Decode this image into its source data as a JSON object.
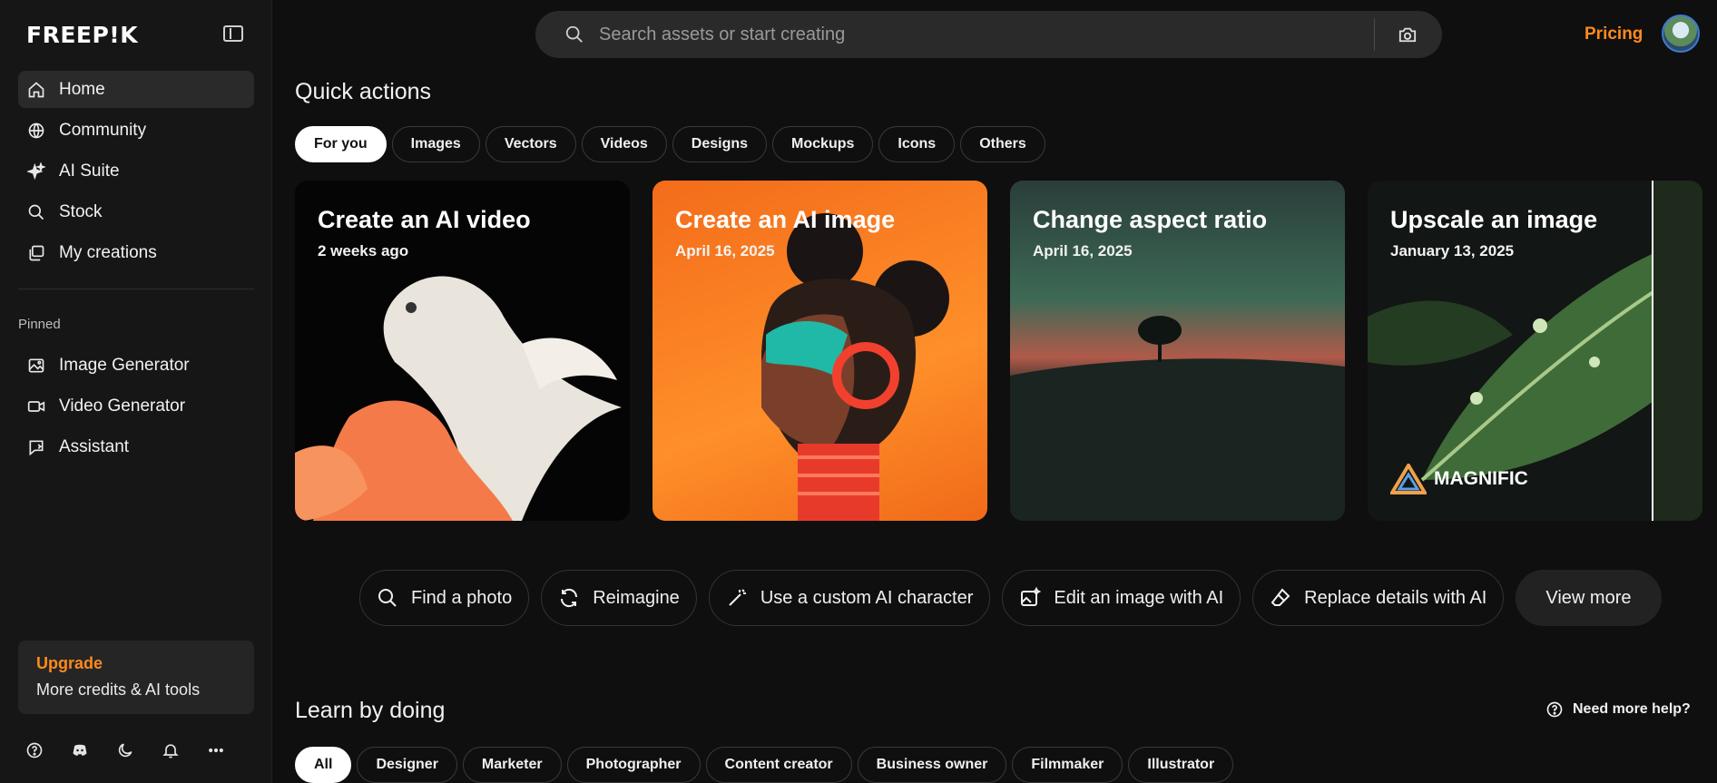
{
  "app": {
    "logo": "FREEP!K"
  },
  "sidebar": {
    "nav": [
      {
        "label": "Home",
        "icon": "home-icon",
        "active": true
      },
      {
        "label": "Community",
        "icon": "globe-icon"
      },
      {
        "label": "AI Suite",
        "icon": "sparkle-icon"
      },
      {
        "label": "Stock",
        "icon": "search-icon"
      },
      {
        "label": "My creations",
        "icon": "stack-icon"
      }
    ],
    "pinned_label": "Pinned",
    "pinned": [
      {
        "label": "Image Generator",
        "icon": "image-icon"
      },
      {
        "label": "Video Generator",
        "icon": "video-icon"
      },
      {
        "label": "Assistant",
        "icon": "assistant-icon"
      }
    ],
    "upgrade": {
      "title": "Upgrade",
      "subtitle": "More credits & AI tools"
    },
    "bottom_icons": [
      "help-icon",
      "discord-icon",
      "moon-icon",
      "bell-icon",
      "more-icon"
    ]
  },
  "header": {
    "search_placeholder": "Search assets or start creating",
    "pricing": "Pricing"
  },
  "quick_actions": {
    "title": "Quick actions",
    "tabs": [
      "For you",
      "Images",
      "Vectors",
      "Videos",
      "Designs",
      "Mockups",
      "Icons",
      "Others"
    ],
    "active_tab": 0,
    "cards": [
      {
        "title": "Create an AI video",
        "date": "2 weeks ago"
      },
      {
        "title": "Create an AI image",
        "date": "April 16, 2025"
      },
      {
        "title": "Change aspect ratio",
        "date": "April 16, 2025"
      },
      {
        "title": "Upscale an image",
        "date": "January 13, 2025",
        "brand": "MAGNIFIC"
      }
    ],
    "actions": [
      {
        "label": "Find a photo",
        "icon": "search-icon"
      },
      {
        "label": "Reimagine",
        "icon": "refresh-icon"
      },
      {
        "label": "Use a custom AI character",
        "icon": "magic-wand-icon"
      },
      {
        "label": "Edit an image with AI",
        "icon": "image-edit-icon"
      },
      {
        "label": "Replace details with AI",
        "icon": "eraser-icon"
      },
      {
        "label": "View more",
        "icon": ""
      }
    ]
  },
  "learn": {
    "title": "Learn by doing",
    "help": "Need more help?",
    "tabs": [
      "All",
      "Designer",
      "Marketer",
      "Photographer",
      "Content creator",
      "Business owner",
      "Filmmaker",
      "Illustrator"
    ],
    "active_tab": 0
  }
}
